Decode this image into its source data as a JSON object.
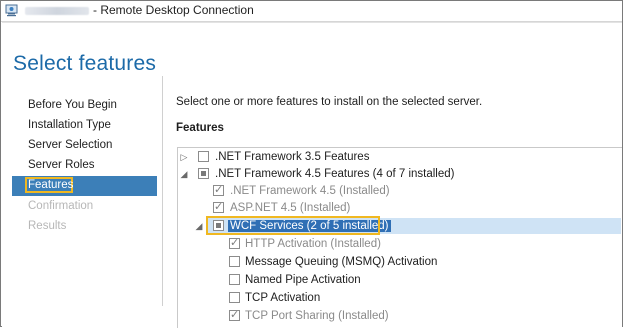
{
  "window": {
    "title": "- Remote Desktop Connection"
  },
  "page": {
    "title": "Select features"
  },
  "nav": {
    "items": [
      {
        "label": "Before You Begin",
        "state": "normal"
      },
      {
        "label": "Installation Type",
        "state": "normal"
      },
      {
        "label": "Server Selection",
        "state": "normal"
      },
      {
        "label": "Server Roles",
        "state": "normal"
      },
      {
        "label": "Features",
        "state": "selected"
      },
      {
        "label": "Confirmation",
        "state": "disabled"
      },
      {
        "label": "Results",
        "state": "disabled"
      }
    ]
  },
  "content": {
    "instruction": "Select one or more features to install on the selected server.",
    "section_label": "Features"
  },
  "features": [
    {
      "label": ".NET Framework 3.5 Features",
      "expander": "collapsed",
      "check": "unchecked",
      "level": 0
    },
    {
      "label": ".NET Framework 4.5 Features (4 of 7 installed)",
      "expander": "expanded",
      "check": "partial",
      "level": 0
    },
    {
      "label": ".NET Framework 4.5 (Installed)",
      "expander": "none",
      "check": "checked",
      "level": 1
    },
    {
      "label": "ASP.NET 4.5 (Installed)",
      "expander": "none",
      "check": "checked",
      "level": 1
    },
    {
      "label": "WCF Services (2 of 5 installed)",
      "expander": "expanded",
      "check": "partial",
      "level": 1,
      "highlight": true
    },
    {
      "label": "HTTP Activation (Installed)",
      "expander": "none",
      "check": "checked",
      "level": 2
    },
    {
      "label": "Message Queuing (MSMQ) Activation",
      "expander": "none",
      "check": "unchecked",
      "level": 2
    },
    {
      "label": "Named Pipe Activation",
      "expander": "none",
      "check": "unchecked",
      "level": 2
    },
    {
      "label": "TCP Activation",
      "expander": "none",
      "check": "unchecked",
      "level": 2
    },
    {
      "label": "TCP Port Sharing (Installed)",
      "expander": "none",
      "check": "checked",
      "level": 2
    }
  ],
  "colors": {
    "accent": "#3c7fb8",
    "title_blue": "#1c6aa8",
    "callout": "#f0b821"
  }
}
